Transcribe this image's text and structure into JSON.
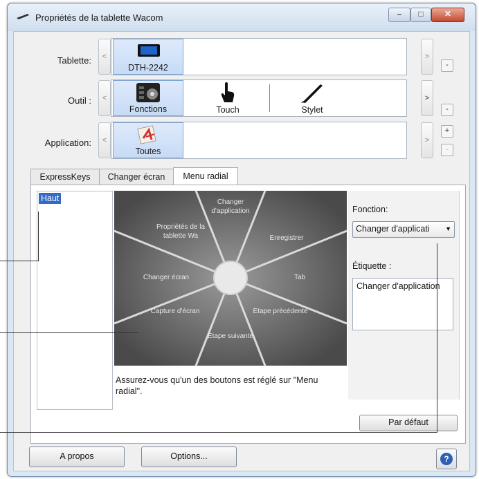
{
  "window": {
    "title": "Propriétés de la tablette Wacom",
    "minimize_glyph": "–",
    "maximize_glyph": "□",
    "close_glyph": "✕"
  },
  "rows": {
    "tablet": {
      "label": "Tablette:",
      "items": [
        {
          "label": "DTH-2242",
          "icon": "tablet-icon",
          "selected": true
        }
      ]
    },
    "tool": {
      "label": "Outil :",
      "items": [
        {
          "label": "Fonctions",
          "icon": "functions-icon",
          "selected": true
        },
        {
          "label": "Touch",
          "icon": "touch-hand-icon",
          "selected": false
        },
        {
          "label": "Stylet",
          "icon": "pen-icon",
          "selected": false
        }
      ]
    },
    "application": {
      "label": "Application:",
      "items": [
        {
          "label": "Toutes",
          "icon": "all-applications-icon",
          "selected": true
        }
      ]
    },
    "arrow_left": "<",
    "arrow_right": ">",
    "add_glyph": "+",
    "remove_glyph": "-"
  },
  "tabs": [
    {
      "label": "ExpressKeys",
      "active": false
    },
    {
      "label": "Changer écran",
      "active": false
    },
    {
      "label": "Menu radial",
      "active": true
    }
  ],
  "list": {
    "items": [
      "Haut"
    ],
    "selected": "Haut"
  },
  "radial_menu": {
    "segments": [
      "Changer d'application",
      "Enregistrer",
      "Tab",
      "Etape précédente",
      "Etape suivante",
      "Capture d'écran",
      "Changer écran",
      "Propriétés de la tablette Wa"
    ]
  },
  "note": "Assurez-vous qu'un des boutons est réglé sur \"Menu radial\".",
  "function_panel": {
    "function_label": "Fonction:",
    "function_value": "Changer d'applicati",
    "caret": "▼",
    "label_label": "Étiquette :",
    "label_value": "Changer d'application"
  },
  "buttons": {
    "default": "Par défaut",
    "about": "A propos",
    "options": "Options...",
    "help": "?"
  }
}
